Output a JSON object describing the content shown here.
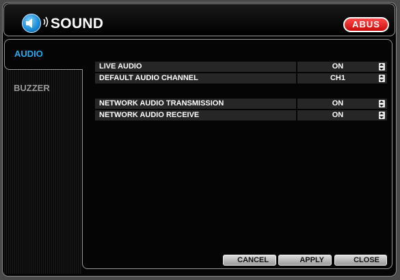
{
  "window": {
    "title": "SOUND",
    "title_icon": "speaker-icon",
    "brand_logo": "ABUS",
    "accent_color": "#2aa9ee",
    "brand_color": "#e21a1a"
  },
  "tabs": [
    {
      "label": "AUDIO",
      "active": true
    },
    {
      "label": "BUZZER",
      "active": false
    }
  ],
  "settings": [
    {
      "label": "LIVE AUDIO",
      "value": "ON"
    },
    {
      "label": "DEFAULT AUDIO CHANNEL",
      "value": "CH1"
    },
    {
      "label": "NETWORK AUDIO TRANSMISSION",
      "value": "ON"
    },
    {
      "label": "NETWORK AUDIO RECEIVE",
      "value": "ON"
    }
  ],
  "buttons": {
    "cancel": "CANCEL",
    "apply": "APPLY",
    "close": "CLOSE"
  }
}
